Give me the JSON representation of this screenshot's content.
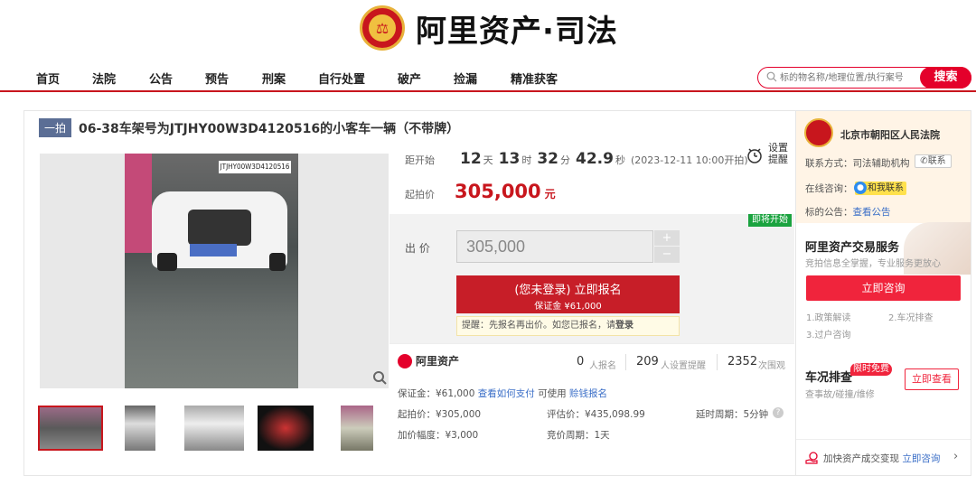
{
  "header": {
    "logo_text": "阿里资产·司法"
  },
  "nav": {
    "items": [
      "首页",
      "法院",
      "公告",
      "预告",
      "刑案",
      "自行处置",
      "破产",
      "捡漏",
      "精准获客"
    ]
  },
  "search": {
    "placeholder": "标的物名称/地理位置/执行案号",
    "button": "搜索"
  },
  "item": {
    "tag": "一拍",
    "title": "06-38车架号为JTJHY00W3D4120516的小客车一辆（不带牌）",
    "photo_label": "JTJHY00W3D4120516"
  },
  "countdown": {
    "label": "距开始",
    "days": "12",
    "days_unit": "天",
    "hours": "13",
    "hours_unit": "时",
    "minutes": "32",
    "minutes_unit": "分",
    "seconds": "42.9",
    "seconds_unit": "秒",
    "start": "(2023-12-11 10:00开拍)"
  },
  "reminder": {
    "line1": "设置",
    "line2": "提醒"
  },
  "start_price": {
    "label": "起拍价",
    "value": "305,000",
    "unit": "元"
  },
  "bid": {
    "soon": "即将开始",
    "label": "出 价",
    "value": "305,000",
    "plus": "+",
    "minus": "−",
    "signup_main": "(您未登录) 立即报名",
    "signup_sub": "保证金 ¥61,000",
    "tip_prefix": "提醒：先报名再出价。如您已报名，请",
    "tip_link": "登录"
  },
  "stats": {
    "brand": "阿里资产",
    "signups": "0",
    "signups_label": "人报名",
    "reminders": "209",
    "reminders_label": "人设置提醒",
    "views": "2352",
    "views_label": "次围观"
  },
  "details": {
    "deposit": "保证金：¥61,000",
    "how_to_pay": "查看如何支付",
    "usable": "可使用",
    "credit": "赊钱报名",
    "start_price": "起拍价：¥305,000",
    "eval_price": "评估价：¥435,098.99",
    "delay": "延时周期：5分钟",
    "increment": "加价幅度：¥3,000",
    "cycle": "竞价周期：1天"
  },
  "court": {
    "name": "北京市朝阳区人民法院",
    "contact_label": "联系方式：司法辅助机构",
    "contact_btn": "联系",
    "online_label": "在线咨询：",
    "online_btn": "和我联系",
    "notice_label": "标的公告：",
    "notice_link": "查看公告"
  },
  "service": {
    "title": "阿里资产交易服务",
    "subtitle": "竞拍信息全掌握，专业服务更放心",
    "button": "立即咨询",
    "items": [
      "1.政策解读",
      "2.车况排查",
      "3.过户咨询"
    ]
  },
  "vehicle_check": {
    "title": "车况排查",
    "badge": "限时免费",
    "subtitle": "查事故/碰撞/维修",
    "button": "立即查看"
  },
  "speedup": {
    "text": "加快资产成交变现",
    "link": "立即咨询",
    "arrow": "›"
  }
}
